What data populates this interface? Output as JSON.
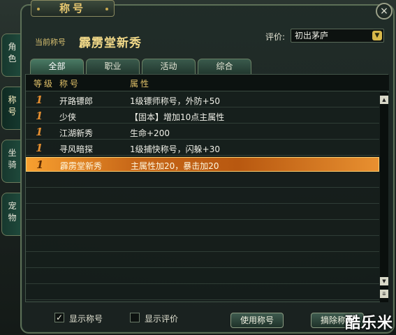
{
  "window": {
    "title": "称号",
    "close_glyph": "×"
  },
  "side_tabs": [
    {
      "label": "角色"
    },
    {
      "label": "称号"
    },
    {
      "label": "坐骑"
    },
    {
      "label": "宠物"
    }
  ],
  "current": {
    "label": "当前称号",
    "value": "霹雳堂新秀"
  },
  "rating": {
    "label": "评价:",
    "value": "初出茅庐"
  },
  "tabs": [
    {
      "label": "全部"
    },
    {
      "label": "职业"
    },
    {
      "label": "活动"
    },
    {
      "label": "综合"
    }
  ],
  "table": {
    "headers": {
      "level": "等级",
      "name": "称号",
      "attr": "属性"
    },
    "rows": [
      {
        "level": "1",
        "name": "开路镖郎",
        "attr": "1级镖师称号，外防+50"
      },
      {
        "level": "1",
        "name": "少侠",
        "attr": "【固本】增加10点主属性"
      },
      {
        "level": "1",
        "name": "江湖新秀",
        "attr": "生命+200"
      },
      {
        "level": "1",
        "name": "寻风暗探",
        "attr": "1级捕快称号，闪躲+30"
      },
      {
        "level": "1",
        "name": "霹雳堂新秀",
        "attr": "主属性加20，暴击加20"
      }
    ],
    "selected_index": 4
  },
  "bottom": {
    "show_title": {
      "label": "显示称号",
      "checked": true,
      "mark": "✓"
    },
    "show_rating": {
      "label": "显示评价",
      "checked": false
    },
    "use_button": "使用称号",
    "remove_button": "摘除称号"
  },
  "watermark": "酷乐米",
  "colors": {
    "selected_row": "#c86818",
    "accent_gold": "#e0c068"
  }
}
